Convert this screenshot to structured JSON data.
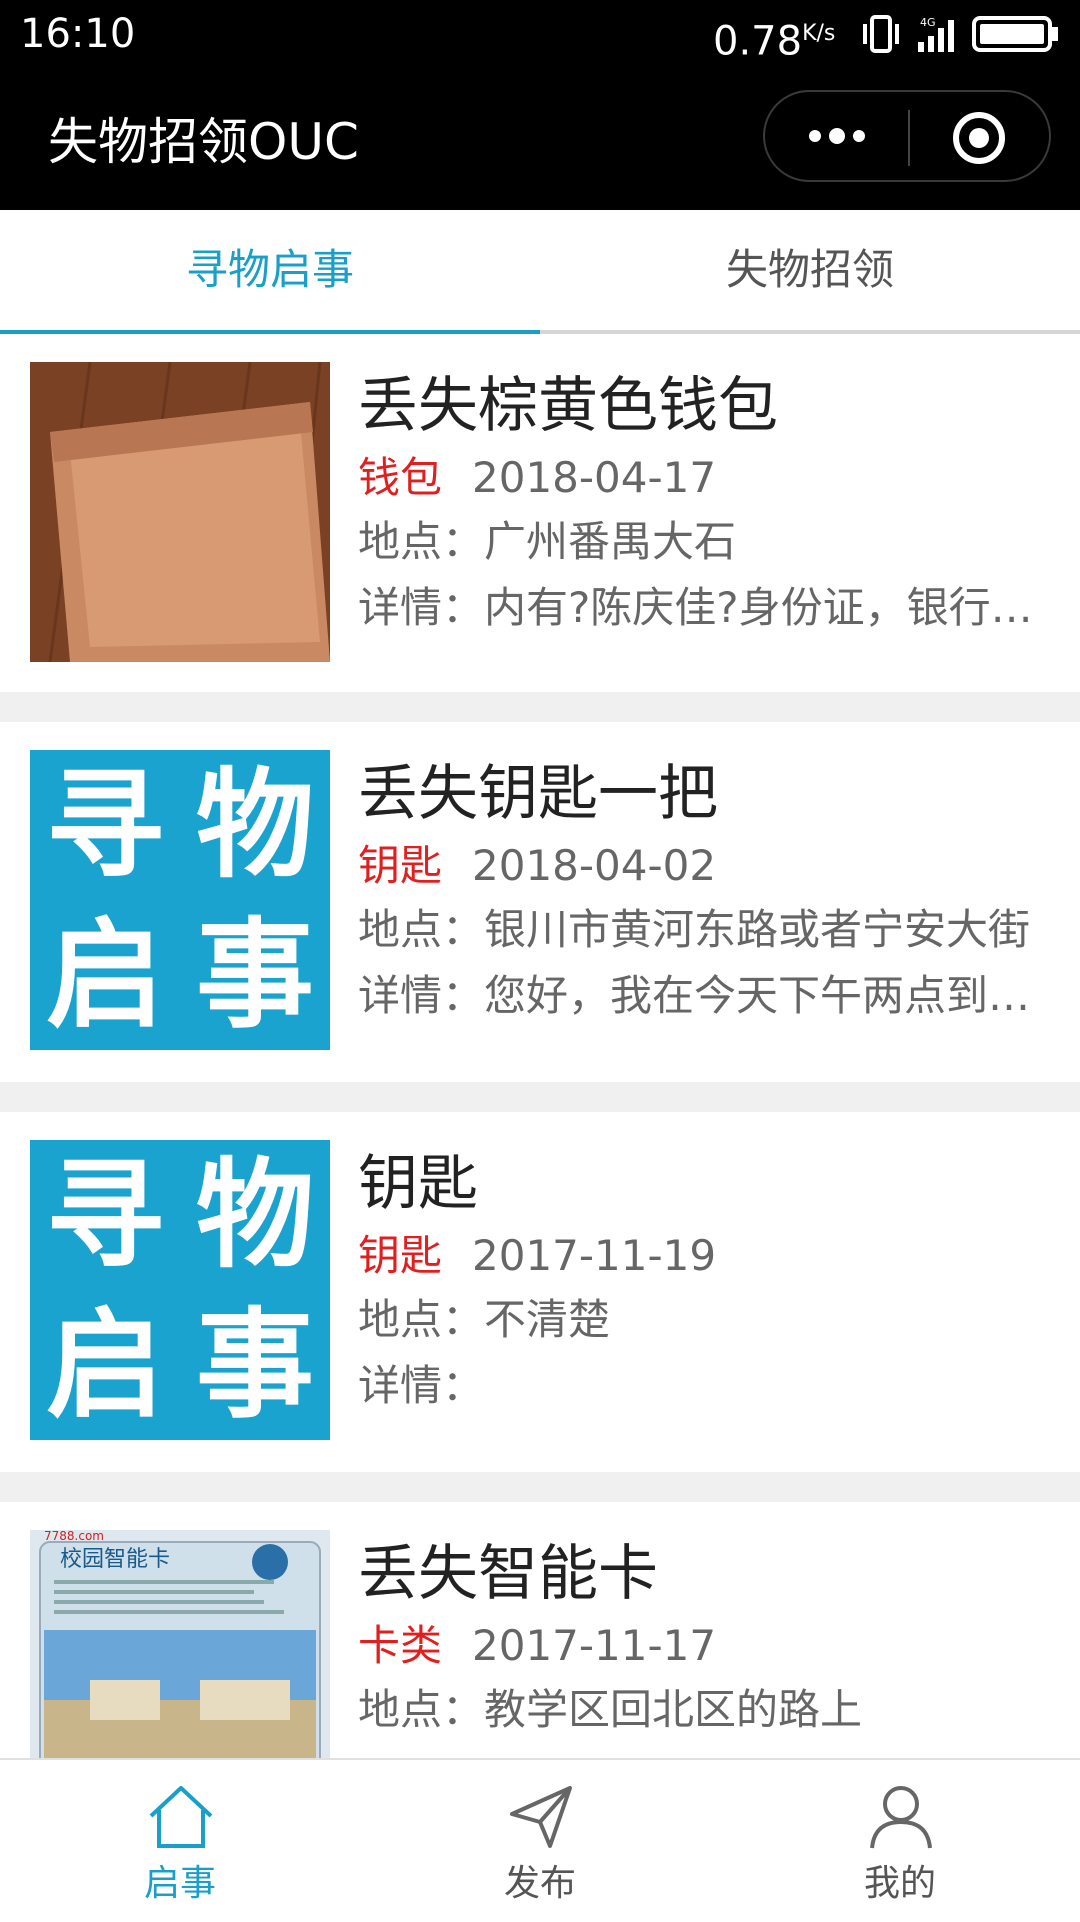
{
  "status_bar": {
    "time": "16:10",
    "network_speed": "0.78",
    "network_unit": "K/s",
    "network_type": "4G",
    "icons": [
      "vibrate-icon",
      "signal-icon",
      "battery-icon"
    ]
  },
  "title_bar": {
    "title": "失物招领OUC",
    "icons": [
      "more-dots-icon",
      "close-target-icon"
    ]
  },
  "tabs": [
    {
      "label": "寻物启事",
      "active": true
    },
    {
      "label": "失物招领",
      "active": false
    }
  ],
  "posts": [
    {
      "title": "丢失棕黄色钱包",
      "category": "钱包",
      "date": "2018-04-17",
      "location_label": "地点：",
      "location": "广州番禺大石",
      "details_label": "详情：",
      "details": "内有?陈庆佳?身份证，银行卡等",
      "thumbnail": "wallet-photo"
    },
    {
      "title": "丢失钥匙一把",
      "category": "钥匙",
      "date": "2018-04-02",
      "location_label": "地点：",
      "location": "银川市黄河东路或者宁安大街",
      "details_label": "详情：",
      "details": "您好，我在今天下午两点到三点",
      "thumbnail": "lost-notice-poster"
    },
    {
      "title": "钥匙",
      "category": "钥匙",
      "date": "2017-11-19",
      "location_label": "地点：",
      "location": "不清楚",
      "details_label": "详情：",
      "details": "",
      "thumbnail": "lost-notice-poster"
    },
    {
      "title": "丢失智能卡",
      "category": "卡类",
      "date": "2017-11-17",
      "location_label": "地点：",
      "location": "教学区回北区的路上",
      "details_label": "详情：",
      "details": "",
      "thumbnail": "campus-card-photo"
    }
  ],
  "poster_text": [
    "寻",
    "物",
    "启",
    "事"
  ],
  "card_photo": {
    "site": "7788.com",
    "caption": "校园智能卡"
  },
  "bottom_nav": [
    {
      "label": "启事",
      "icon": "home-icon",
      "active": true
    },
    {
      "label": "发布",
      "icon": "send-icon",
      "active": false
    },
    {
      "label": "我的",
      "icon": "user-icon",
      "active": false
    }
  ],
  "colors": {
    "accent": "#1aa0c8",
    "category_red": "#e02020",
    "header_bg": "#000000",
    "poster_blue": "#1ba3cf"
  }
}
